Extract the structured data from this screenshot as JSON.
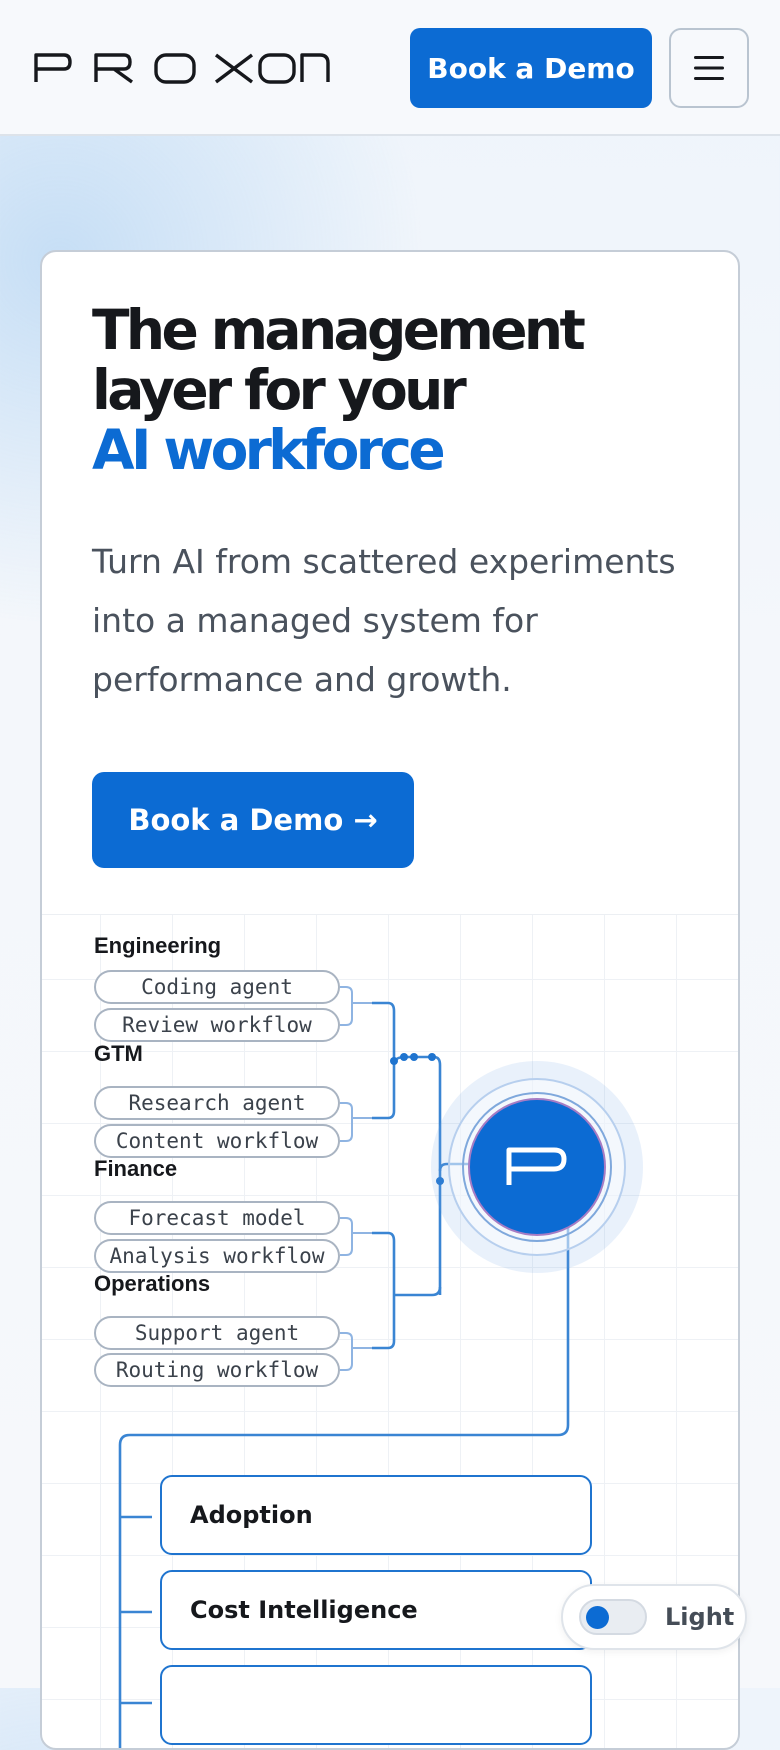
{
  "brand": {
    "name": "PROXON"
  },
  "nav": {
    "cta_label": "Book a Demo",
    "menu_icon": "hamburger-icon"
  },
  "hero": {
    "headline_line1": "The management",
    "headline_line2": "layer for your",
    "headline_accent": "AI workforce",
    "subtitle": "Turn AI from scattered experiments into a managed system for performance and growth.",
    "cta_label": "Book a Demo →"
  },
  "diagram": {
    "groups": [
      {
        "label": "Engineering",
        "items": [
          "Coding agent",
          "Review workflow"
        ]
      },
      {
        "label": "GTM",
        "items": [
          "Research agent",
          "Content workflow"
        ]
      },
      {
        "label": "Finance",
        "items": [
          "Forecast model",
          "Analysis workflow"
        ]
      },
      {
        "label": "Operations",
        "items": [
          "Support agent",
          "Routing workflow"
        ]
      }
    ],
    "hub_icon": "proxon-p-icon",
    "modules": [
      "Adoption",
      "Cost Intelligence",
      ""
    ]
  },
  "theme_toggle": {
    "label": "Light"
  },
  "colors": {
    "accent": "#0c6bd3",
    "text": "#16181c",
    "muted": "#4a525d"
  }
}
